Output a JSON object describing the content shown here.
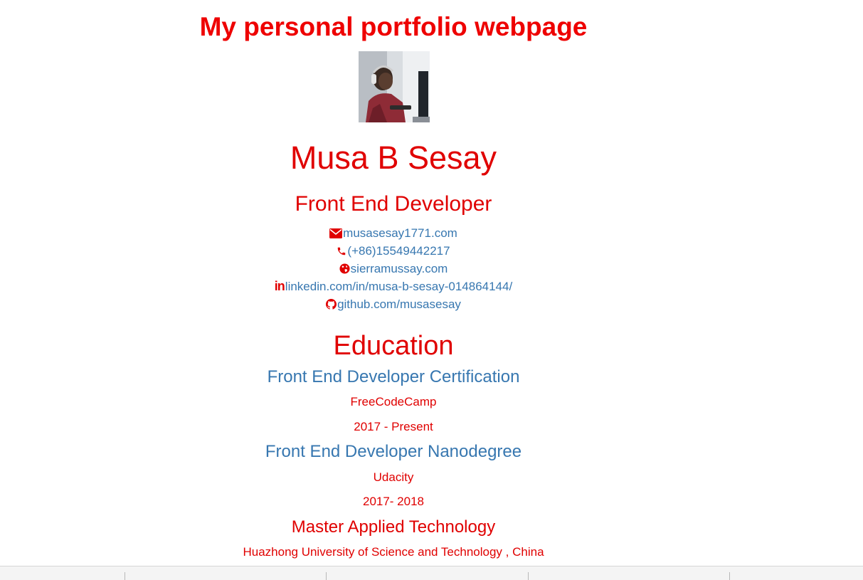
{
  "page": {
    "title": "My personal portfolio webpage"
  },
  "profile": {
    "photo_icon": "profile-photo",
    "name": "Musa B Sesay",
    "role": "Front End Developer"
  },
  "contacts": [
    {
      "icon": "envelope-icon",
      "text": "musasesay1771.com"
    },
    {
      "icon": "phone-icon",
      "text": "(+86)15549442217"
    },
    {
      "icon": "globe-icon",
      "text": "sierramussay.com"
    },
    {
      "icon": "linkedin-icon",
      "icon_text": "in",
      "text": "linkedin.com/in/musa-b-sesay-014864144/"
    },
    {
      "icon": "github-icon",
      "text": "github.com/musasesay"
    }
  ],
  "education": {
    "heading": "Education",
    "items": [
      {
        "course": "Front End Developer Certification",
        "school": "FreeCodeCamp",
        "dates": "2017 - Present"
      },
      {
        "course": "Front End Developer Nanodegree",
        "school": "Udacity",
        "dates": "2017- 2018"
      },
      {
        "course": "Master Applied Technology",
        "school": "Huazhong University of Science and Technology , China"
      }
    ]
  },
  "colors": {
    "accent_red": "#e00000",
    "link_blue": "#3777b0",
    "background": "#ffffff"
  }
}
